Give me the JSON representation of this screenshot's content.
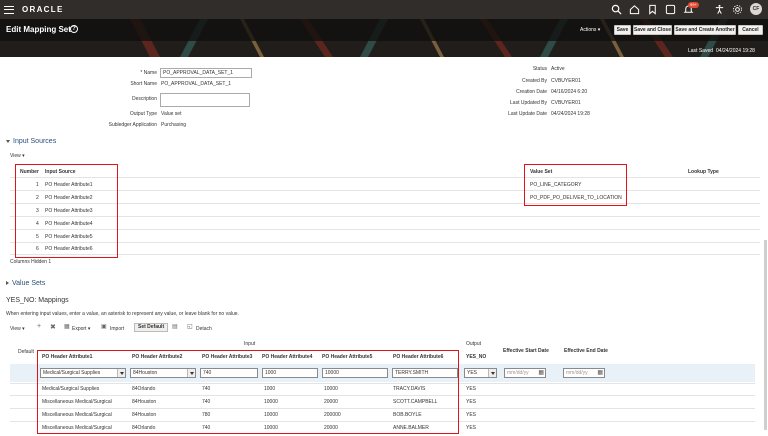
{
  "header": {
    "brand": "ORACLE",
    "notification_count": "99+",
    "avatar_initials": "CF"
  },
  "page": {
    "title": "Edit Mapping Set",
    "actions_label": "Actions",
    "buttons": {
      "save": "Save",
      "save_close": "Save and Close",
      "save_create": "Save and Create Another",
      "cancel": "Cancel"
    },
    "last_saved_label": "Last Saved",
    "last_saved_value": "04/24/2024 19:28"
  },
  "form": {
    "name_label": "Name",
    "name_value": "PO_APPROVAL_DATA_SET_1",
    "short_name_label": "Short Name",
    "short_name_value": "PO_APPROVAL_DATA_SET_1",
    "description_label": "Description",
    "output_type_label": "Output Type",
    "output_type_value": "Value set",
    "subledger_label": "Subledger Application",
    "subledger_value": "Purchasing",
    "status_label": "Status",
    "status_value": "Active",
    "created_by_label": "Created By",
    "created_by_value": "CVBUYER01",
    "creation_date_label": "Creation Date",
    "creation_date_value": "04/16/2024 6:20",
    "last_updated_by_label": "Last Updated By",
    "last_updated_by_value": "CVBUYER01",
    "last_update_date_label": "Last Update Date",
    "last_update_date_value": "04/24/2024 19:28"
  },
  "input_sources": {
    "title": "Input Sources",
    "view_label": "View",
    "col_number": "Number",
    "col_source": "Input Source",
    "col_value_set": "Value Set",
    "col_lookup_type": "Lookup Type",
    "rows": [
      {
        "num": "1",
        "source": "PO Header Attribute1",
        "value_set": "PO_LINE_CATEGORY"
      },
      {
        "num": "2",
        "source": "PO Header Attribute2",
        "value_set": "PO_PDF_PO_DELIVER_TO_LOCATION"
      },
      {
        "num": "3",
        "source": "PO Header Attribute3",
        "value_set": ""
      },
      {
        "num": "4",
        "source": "PO Header Attribute4",
        "value_set": ""
      },
      {
        "num": "5",
        "source": "PO Header Attribute5",
        "value_set": ""
      },
      {
        "num": "6",
        "source": "PO Header Attribute6",
        "value_set": ""
      }
    ],
    "columns_hidden_label": "Columns Hidden",
    "columns_hidden_value": "1"
  },
  "value_sets": {
    "title": "Value Sets"
  },
  "mappings": {
    "title": "YES_NO: Mappings",
    "instructions": "When entering input values, enter a value, an asterisk to represent any value, or leave blank for no value.",
    "toolbar": {
      "view": "View",
      "export": "Export",
      "import": "Import",
      "set_default": "Set Default",
      "detach": "Detach"
    },
    "group_input": "Input",
    "group_output": "Output",
    "col_default": "Default",
    "columns": [
      "PO Header Attribute1",
      "PO Header Attribute2",
      "PO Header Attribute3",
      "PO Header Attribute4",
      "PO Header Attribute5",
      "PO Header Attribute6"
    ],
    "col_output": "YES_NO",
    "col_start": "Effective Start Date",
    "col_end": "Effective End Date",
    "edit_row": {
      "a1": "Medical/Surgical Supplies",
      "a2": "84Houston",
      "a3": "740",
      "a4": "1000",
      "a5": "10000",
      "a6": "TERRY.SMITH",
      "output": "YES",
      "date_placeholder": "mm/dd/yy"
    },
    "rows": [
      {
        "a1": "Medical/Surgical Supplies",
        "a2": "84Orlando",
        "a3": "740",
        "a4": "1000",
        "a5": "10000",
        "a6": "TRACY.DAVIS",
        "output": "YES"
      },
      {
        "a1": "Miscellaneous Medical/Surgical",
        "a2": "84Houston",
        "a3": "740",
        "a4": "10000",
        "a5": "20000",
        "a6": "SCOTT.CAMPBELL",
        "output": "YES"
      },
      {
        "a1": "Miscellaneous Medical/Surgical",
        "a2": "84Houston",
        "a3": "780",
        "a4": "10000",
        "a5": "200000",
        "a6": "BOB.BOYLE",
        "output": "YES"
      },
      {
        "a1": "Miscellaneous Medical/Surgical",
        "a2": "84Orlando",
        "a3": "740",
        "a4": "10000",
        "a5": "20000",
        "a6": "ANNE.BALMER",
        "output": "YES"
      }
    ]
  },
  "colors": {
    "header_bg": "#312d2a",
    "band_bg": "#201d1b",
    "highlight_red": "#e0121a",
    "section_blue": "#2a4f7c"
  }
}
